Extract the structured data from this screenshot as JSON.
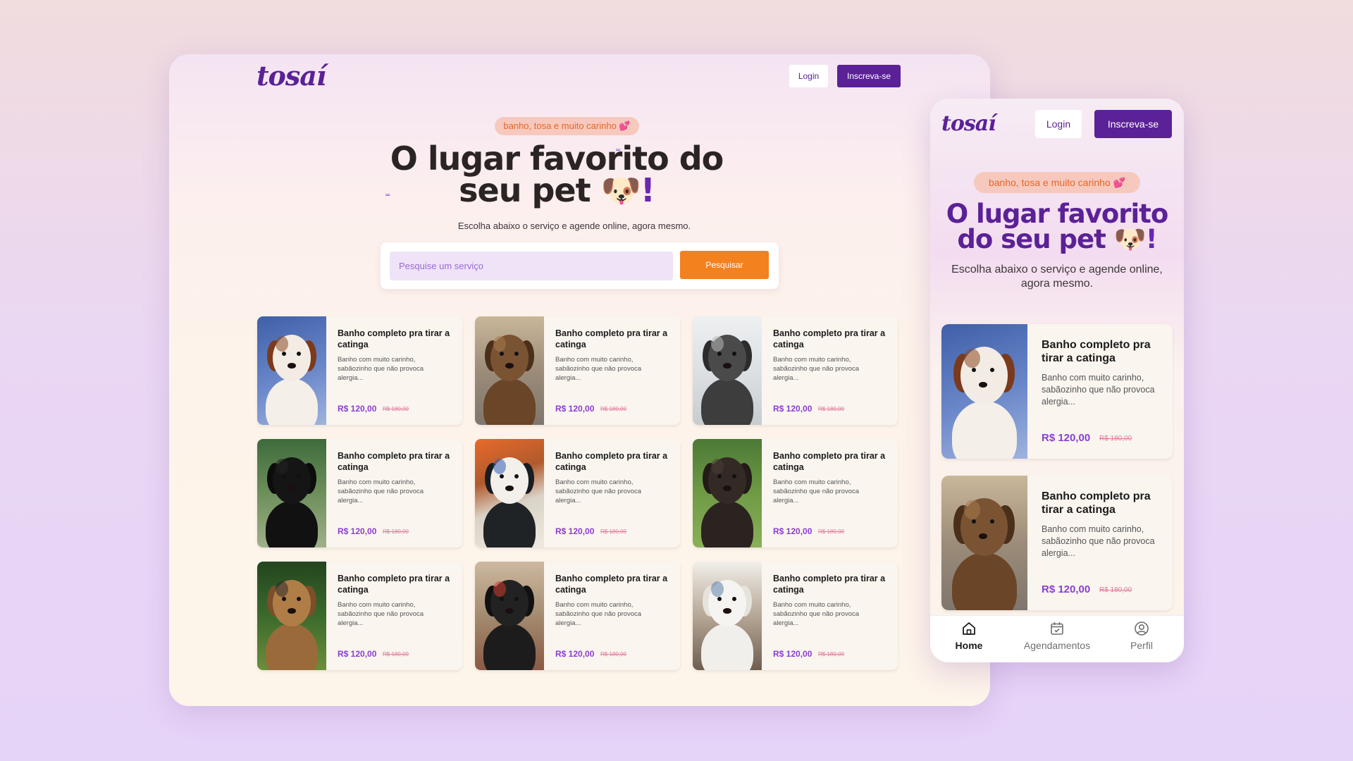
{
  "brand": {
    "logo": "tosaí",
    "primary": "#5b2196",
    "accent": "#f3811e",
    "price_color": "#8a3ed3"
  },
  "header": {
    "login_label": "Login",
    "signup_label": "Inscreva-se"
  },
  "hero": {
    "tagline": "banho, tosa e muito carinho 💕",
    "title": "O lugar favorito do seu pet",
    "title_emoji": "🐶",
    "title_bang": "!",
    "subtitle": "Escolha abaixo o serviço e agende online, agora mesmo."
  },
  "search": {
    "placeholder": "Pesquise um serviço",
    "button_label": "Pesquisar"
  },
  "services": [
    {
      "title": "Banho completo pra tirar a catinga",
      "description": "Banho com muito carinho, sabãozinho que não provoca alergia...",
      "price": "R$ 120,00",
      "old_price": "R$ 180,00",
      "photo": "saint-bernard"
    },
    {
      "title": "Banho completo pra tirar a catinga",
      "description": "Banho com muito carinho, sabãozinho que não provoca alergia...",
      "price": "R$ 120,00",
      "old_price": "R$ 180,00",
      "photo": "yorkshire"
    },
    {
      "title": "Banho completo pra tirar a catinga",
      "description": "Banho com muito carinho, sabãozinho que não provoca alergia...",
      "price": "R$ 120,00",
      "old_price": "R$ 180,00",
      "photo": "husky"
    },
    {
      "title": "Banho completo pra tirar a catinga",
      "description": "Banho com muito carinho, sabãozinho que não provoca alergia...",
      "price": "R$ 120,00",
      "old_price": "R$ 180,00",
      "photo": "affenpinscher"
    },
    {
      "title": "Banho completo pra tirar a catinga",
      "description": "Banho com muito carinho, sabãozinho que não provoca alergia...",
      "price": "R$ 120,00",
      "old_price": "R$ 180,00",
      "photo": "boston-terrier"
    },
    {
      "title": "Banho completo pra tirar a catinga",
      "description": "Banho com muito carinho, sabãozinho que não provoca alergia...",
      "price": "R$ 120,00",
      "old_price": "R$ 180,00",
      "photo": "brindle-dog"
    },
    {
      "title": "Banho completo pra tirar a catinga",
      "description": "Banho com muito carinho, sabãozinho que não provoca alergia...",
      "price": "R$ 120,00",
      "old_price": "R$ 180,00",
      "photo": "airedale"
    },
    {
      "title": "Banho completo pra tirar a catinga",
      "description": "Banho com muito carinho, sabãozinho que não provoca alergia...",
      "price": "R$ 120,00",
      "old_price": "R$ 180,00",
      "photo": "scottish-terrier"
    },
    {
      "title": "Banho completo pra tirar a catinga",
      "description": "Banho com muito carinho, sabãozinho que não provoca alergia...",
      "price": "R$ 120,00",
      "old_price": "R$ 180,00",
      "photo": "white-dog"
    }
  ],
  "mobile": {
    "services": [
      {
        "title": "Banho completo pra tirar a catinga",
        "description": "Banho com muito carinho, sabãozinho que não provoca alergia...",
        "price": "R$ 120,00",
        "old_price": "R$ 180,00",
        "photo": "saint-bernard"
      },
      {
        "title": "Banho completo pra tirar a catinga",
        "description": "Banho com muito carinho, sabãozinho que não provoca alergia...",
        "price": "R$ 120,00",
        "old_price": "R$ 180,00",
        "photo": "yorkshire"
      }
    ],
    "tabs": [
      {
        "label": "Home",
        "icon": "home-icon",
        "active": true
      },
      {
        "label": "Agendamentos",
        "icon": "calendar-icon",
        "active": false
      },
      {
        "label": "Perfil",
        "icon": "profile-icon",
        "active": false
      }
    ]
  }
}
